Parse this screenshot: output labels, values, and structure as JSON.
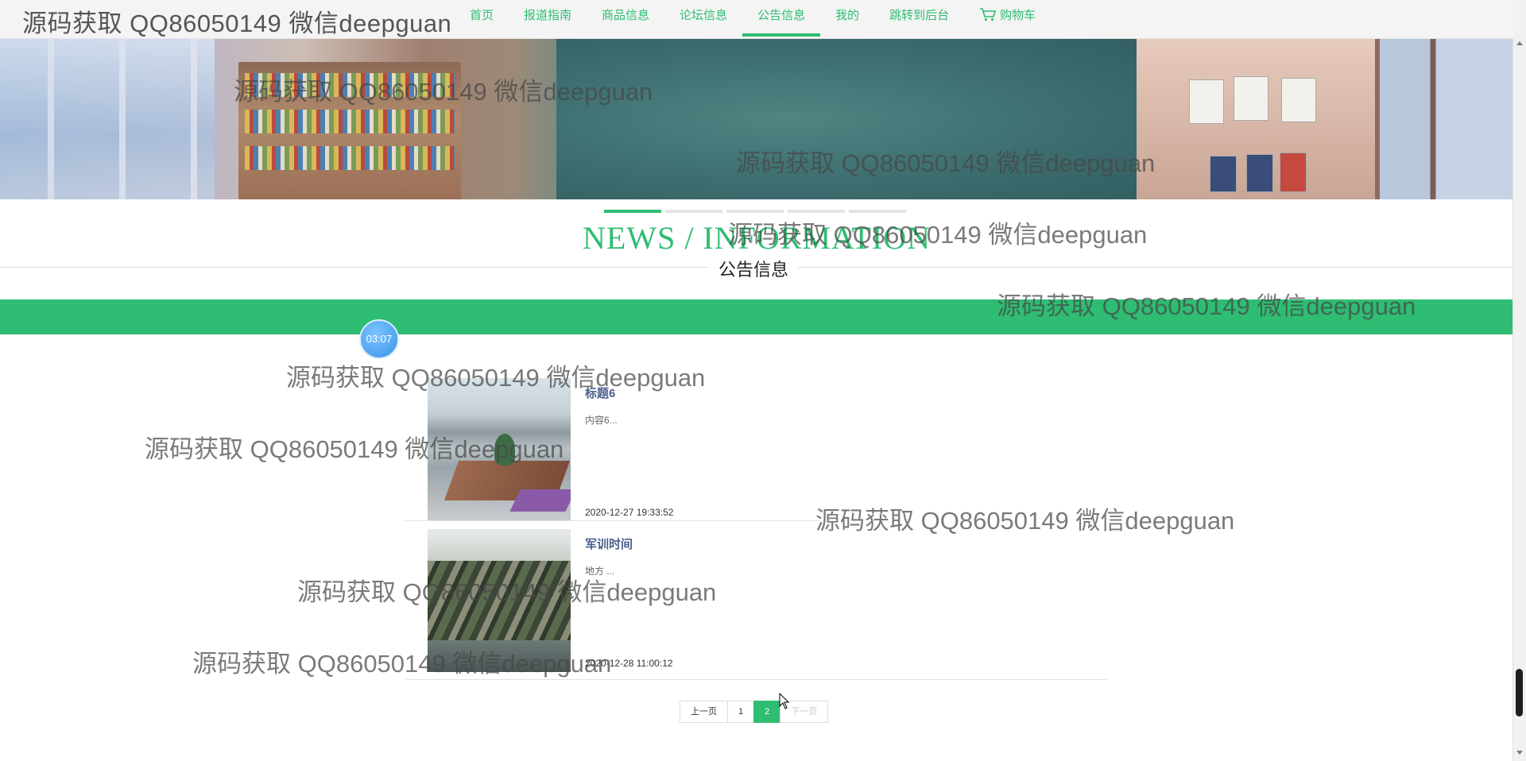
{
  "header": {
    "site_title": "源码获取 QQ86050149 微信deepguan",
    "nav": [
      {
        "label": "首页",
        "active": false
      },
      {
        "label": "报道指南",
        "active": false
      },
      {
        "label": "商品信息",
        "active": false
      },
      {
        "label": "论坛信息",
        "active": false
      },
      {
        "label": "公告信息",
        "active": true
      },
      {
        "label": "我的",
        "active": false
      },
      {
        "label": "跳转到后台",
        "active": false
      }
    ],
    "cart_label": "购物车",
    "cart_icon": "shopping-cart-icon"
  },
  "section": {
    "title_en": "NEWS / INFORMATION",
    "title_cn": "公告信息"
  },
  "time_badge": "03:07",
  "news": [
    {
      "title": "标题6",
      "content": "内容6...",
      "date": "2020-12-27 19:33:52"
    },
    {
      "title": "军训时间",
      "content": "地方 ...",
      "date": "2020-12-28 11:00:12"
    }
  ],
  "pagination": {
    "prev": "上一页",
    "pages": [
      "1",
      "2"
    ],
    "current": "2",
    "next": "下一页"
  },
  "watermark": "源码获取 QQ86050149 微信deepguan",
  "colors": {
    "accent": "#2ebd72",
    "title_link": "#4a5f8c",
    "time_badge": "#3b93e8"
  }
}
